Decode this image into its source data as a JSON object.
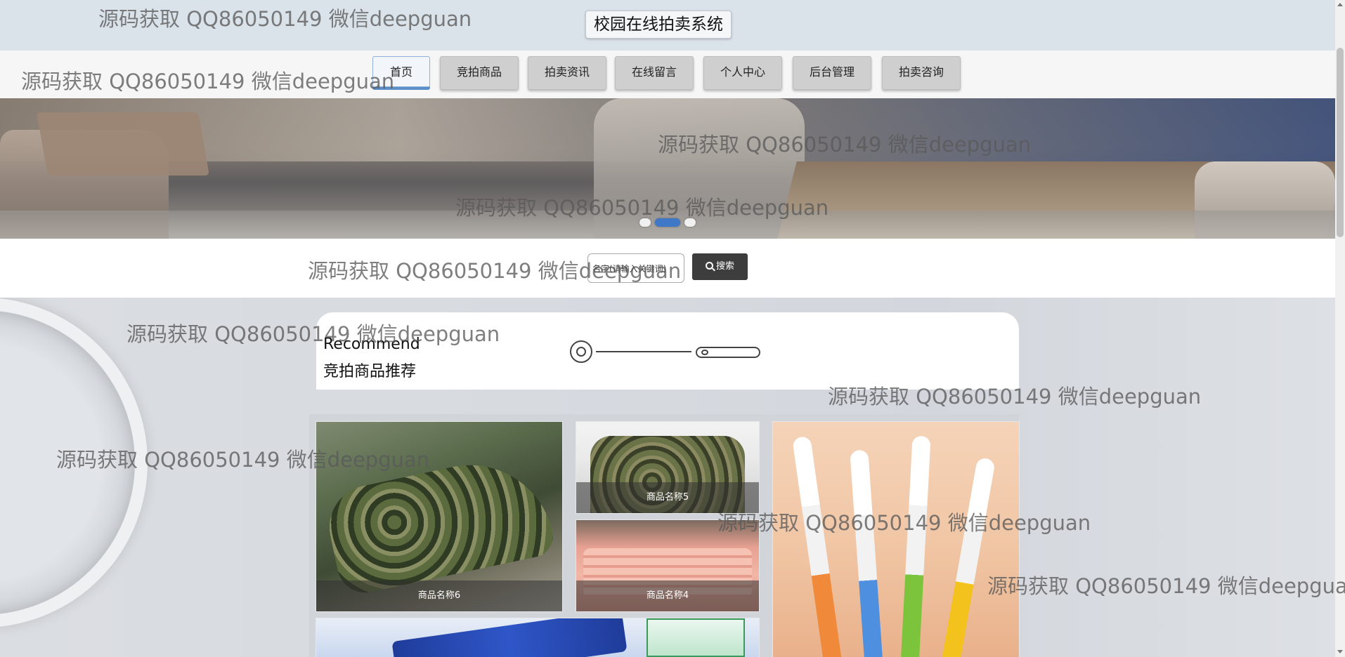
{
  "header": {
    "site_title": "校园在线拍卖系统"
  },
  "nav": {
    "items": [
      {
        "label": "首页",
        "active": true
      },
      {
        "label": "竞拍商品"
      },
      {
        "label": "拍卖资讯"
      },
      {
        "label": "在线留言"
      },
      {
        "label": "个人中心"
      },
      {
        "label": "后台管理"
      },
      {
        "label": "拍卖咨询"
      }
    ]
  },
  "banner": {
    "active_slide_index": 1,
    "slide_count": 3
  },
  "search": {
    "placeholder": "名字(请输入关键词)",
    "value": "名字(请输入关键词)",
    "button_label": "搜索",
    "button_icon": "search-icon"
  },
  "section": {
    "title_en": "Recommend",
    "title_cn": "竞拍商品推荐"
  },
  "products": [
    {
      "name": "商品名称6"
    },
    {
      "name": "商品名称5"
    },
    {
      "name": "商品名称4"
    },
    {
      "name": ""
    },
    {
      "name": ""
    }
  ],
  "watermark": {
    "text": "源码获取 QQ86050149 微信deepguan"
  },
  "colors": {
    "nav_active_border": "#5b8fc9",
    "search_button": "#3d3d3d",
    "topbar": "#dbe3ea"
  }
}
